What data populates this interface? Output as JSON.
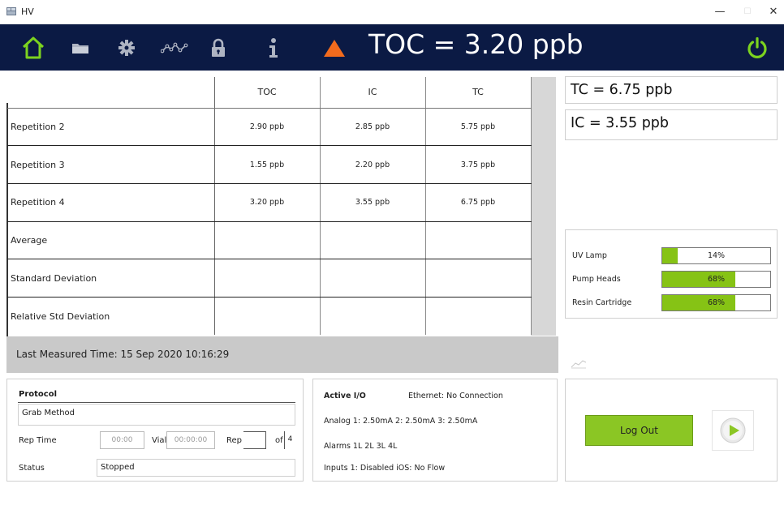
{
  "window": {
    "title": "HV"
  },
  "header": {
    "toc_reading": "TOC = 3.20 ppb"
  },
  "table": {
    "columns": [
      "TOC",
      "IC",
      "TC"
    ],
    "rows": [
      {
        "label": "Repetition 2",
        "values": [
          "2.90 ppb",
          "2.85 ppb",
          "5.75 ppb"
        ]
      },
      {
        "label": "Repetition 3",
        "values": [
          "1.55 ppb",
          "2.20 ppb",
          "3.75 ppb"
        ]
      },
      {
        "label": "Repetition 4",
        "values": [
          "3.20 ppb",
          "3.55 ppb",
          "6.75 ppb"
        ]
      },
      {
        "label": "Average",
        "values": [
          "",
          "",
          ""
        ]
      },
      {
        "label": "Standard Deviation",
        "values": [
          "",
          "",
          ""
        ]
      },
      {
        "label": "Relative Std Deviation",
        "values": [
          "",
          "",
          ""
        ]
      }
    ],
    "last_measured": "Last Measured Time:  15 Sep 2020  10:16:29"
  },
  "readings": {
    "tc": "TC = 6.75 ppb",
    "ic": "IC = 3.55 ppb"
  },
  "consumables": [
    {
      "label": "UV Lamp",
      "percent": 14,
      "text": "14%"
    },
    {
      "label": "Pump Heads",
      "percent": 68,
      "text": "68%"
    },
    {
      "label": "Resin Cartridge",
      "percent": 68,
      "text": "68%"
    }
  ],
  "protocol": {
    "heading": "Protocol",
    "method": "Grab Method",
    "rep_time_label": "Rep Time",
    "rep_time_value": "00:00",
    "vial_label": "Vial",
    "vial_value": "00:00:00",
    "rep_label": "Rep",
    "rep_value": "",
    "of_label": "of",
    "of_value": "4",
    "status_label": "Status",
    "status_value": "Stopped"
  },
  "active_io": {
    "heading": "Active I/O",
    "ethernet": "Ethernet: No Connection",
    "analog": "Analog 1: 2.50mA  2: 2.50mA  3: 2.50mA",
    "alarms": "Alarms 1L 2L 3L 4L",
    "inputs": "Inputs 1: Disabled  iOS: No Flow"
  },
  "actions": {
    "logout": "Log Out"
  },
  "colors": {
    "toolbar": "#0b1a44",
    "accent_green": "#8bc624",
    "warning_orange": "#f26b1d",
    "power_green": "#7cd31f"
  },
  "icons": [
    "home-icon",
    "folder-icon",
    "gear-icon",
    "trend-icon",
    "lock-icon",
    "info-icon",
    "warning-triangle-icon",
    "power-icon",
    "play-icon"
  ]
}
